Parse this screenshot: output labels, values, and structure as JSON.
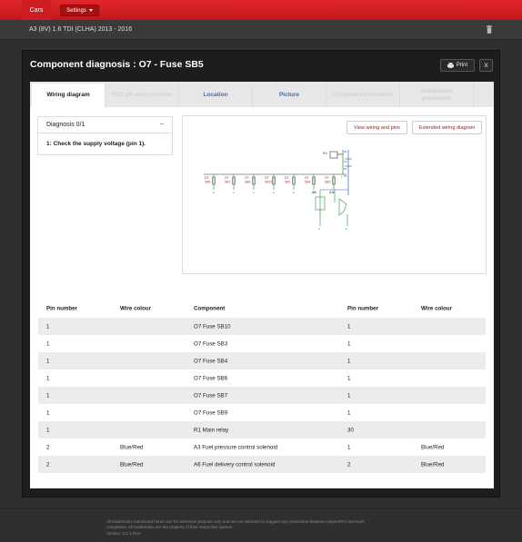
{
  "topbar": {
    "active_tab": "Cars",
    "settings_label": "Settings"
  },
  "vehicle": {
    "title": "A3 (8V) 1.6 TDI (CLHA) 2013 - 2016"
  },
  "modal": {
    "title": "Component diagnosis : O7 - Fuse SB5",
    "print_label": "Print",
    "close_label": "X"
  },
  "tabs": [
    {
      "label": "Wiring diagram",
      "state": "active"
    },
    {
      "label": "ECU pin and connector",
      "state": "disabled"
    },
    {
      "label": "Location",
      "state": "link"
    },
    {
      "label": "Picture",
      "state": "link"
    },
    {
      "label": "Component information",
      "state": "disabled"
    },
    {
      "label": "Initialisation procedures",
      "state": "disabled"
    }
  ],
  "diagnosis": {
    "header": "Diagnosis 0/1",
    "collapse_symbol": "−",
    "step": "1: Check the supply voltage (pin 1)."
  },
  "wiring": {
    "view_pins_label": "View wiring and pins",
    "extended_label": "Extended wiring diagram",
    "fuses": [
      {
        "code": "O7",
        "name": "SB9"
      },
      {
        "code": "O7",
        "name": "SB7"
      },
      {
        "code": "O7",
        "name": "SB6"
      },
      {
        "code": "O7",
        "name": "SB10"
      },
      {
        "code": "O7",
        "name": "SB3"
      },
      {
        "code": "O7",
        "name": "SB4"
      },
      {
        "code": "O7",
        "name": "SB5"
      }
    ],
    "relay": "R1",
    "relay_pins": [
      "86",
      "30",
      "85",
      "87"
    ],
    "sensors": [
      "A6",
      "A3"
    ],
    "pin_label": "2",
    "top_pin_label": "1"
  },
  "table": {
    "headers": [
      "Pin number",
      "Wire colour",
      "Component",
      "Pin number",
      "Wire colour"
    ],
    "rows": [
      [
        "1",
        "",
        "O7 Fuse SB10",
        "1",
        ""
      ],
      [
        "1",
        "",
        "O7 Fuse SB3",
        "1",
        ""
      ],
      [
        "1",
        "",
        "O7 Fuse SB4",
        "1",
        ""
      ],
      [
        "1",
        "",
        "O7 Fuse SB6",
        "1",
        ""
      ],
      [
        "1",
        "",
        "O7 Fuse SB7",
        "1",
        ""
      ],
      [
        "1",
        "",
        "O7 Fuse SB9",
        "1",
        ""
      ],
      [
        "1",
        "",
        "R1 Main relay",
        "30",
        ""
      ],
      [
        "2",
        "Blue/Red",
        "A3 Fuel pressure control solenoid",
        "1",
        "Blue/Red"
      ],
      [
        "2",
        "Blue/Red",
        "A6 Fuel delivery control solenoid",
        "2",
        "Blue/Red"
      ]
    ]
  },
  "footer": {
    "line1": "All trademarks mentioned herein are for reference purpose only and are not intended to suggest any connection between HaynesPro and such",
    "line2": "companies. All trademarks are the property of their respective owners.",
    "line3": "Version: 3.2.1-R14"
  },
  "colors": {
    "brand": "#d01d21",
    "link": "#3a6fb0",
    "wire_green": "#2e8b3a",
    "wire_blue": "#3b5fc0",
    "fuse_red": "#c0282b"
  }
}
